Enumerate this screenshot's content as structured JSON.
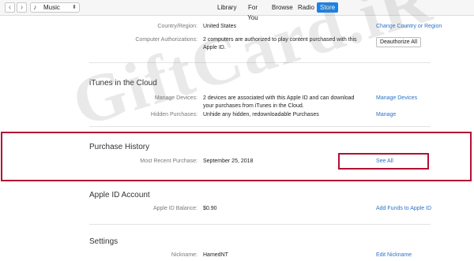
{
  "toolbar": {
    "back_glyph": "‹",
    "forward_glyph": "›",
    "media_icon": "music-note-icon",
    "media_value": "Music",
    "tabs": [
      {
        "label": "Library"
      },
      {
        "label": "For You"
      },
      {
        "label": "Browse"
      },
      {
        "label": "Radio"
      },
      {
        "label": "Store",
        "active": true
      }
    ]
  },
  "account": {
    "country_label": "Country/Region:",
    "country_value": "United States",
    "country_link": "Change Country or Region",
    "auth_label": "Computer Authorizations:",
    "auth_value": "2 computers are authorized to play content purchased with this Apple ID.",
    "deauthorize_label": "Deauthorize All"
  },
  "cloud": {
    "title": "iTunes in the Cloud",
    "devices_label": "Manage Devices:",
    "devices_value": "2 devices are associated with this Apple ID and can download your purchases from iTunes in the Cloud.",
    "devices_link": "Manage Devices",
    "hidden_label": "Hidden Purchases:",
    "hidden_value": "Unhide any hidden, redownloadable Purchases",
    "hidden_link": "Manage"
  },
  "purchase": {
    "title": "Purchase History",
    "recent_label": "Most Recent Purchase:",
    "recent_value": "September 25, 2018",
    "see_all": "See All"
  },
  "appleid": {
    "title": "Apple ID Account",
    "balance_label": "Apple ID Balance:",
    "balance_value": "$0.90",
    "add_funds": "Add Funds to Apple ID"
  },
  "settings": {
    "title": "Settings",
    "nickname_label": "Nickname:",
    "nickname_value": "HamedNT",
    "edit_nickname": "Edit Nickname"
  },
  "watermark": "GiftCard.iR",
  "colors": {
    "accent": "#1a82e6",
    "link": "#2a74c9",
    "highlight": "#b40f33"
  }
}
